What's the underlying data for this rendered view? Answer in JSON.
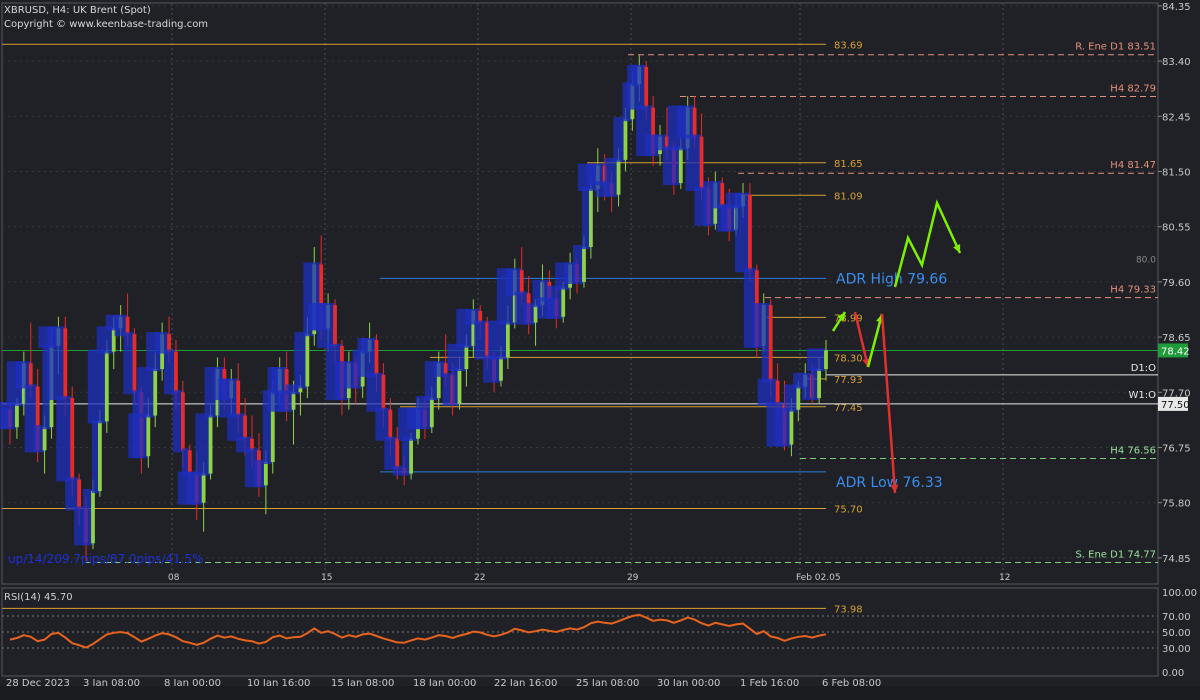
{
  "header": {
    "title": "XBRUSD, H4:  UK Brent (Spot)",
    "copyright": "Copyright © www.keenbase-trading.com"
  },
  "chart_data": {
    "type": "candlestick",
    "symbol": "XBRUSD",
    "timeframe": "H4",
    "ylim": [
      74.4,
      84.4
    ],
    "price_ticks": [
      "84.35",
      "83.40",
      "82.45",
      "81.50",
      "80.55",
      "79.60",
      "78.65",
      "77.70",
      "76.75",
      "75.80",
      "74.85"
    ],
    "date_ticks": [
      "28 Dec 2023",
      "3 Jan 08:00",
      "8 Jan 00:00",
      "10 Jan 16:00",
      "15 Jan 08:00",
      "18 Jan 00:00",
      "22 Jan 16:00",
      "25 Jan 08:00",
      "30 Jan 00:00",
      "1 Feb 16:00",
      "6 Feb 08:00"
    ],
    "period_separators": [
      "08",
      "15",
      "22",
      "29",
      "Feb 02.05",
      "12"
    ],
    "current_price": "78.42",
    "level_lines": [
      {
        "price": 83.69,
        "label": "83.69",
        "color": "#d7a034"
      },
      {
        "price": 81.65,
        "label": "81.65",
        "color": "#d7a034"
      },
      {
        "price": 81.09,
        "label": "81.09",
        "color": "#d7a034"
      },
      {
        "price": 78.99,
        "label": "78.99",
        "color": "#d7a034"
      },
      {
        "price": 78.3,
        "label": "78.30",
        "color": "#d7a034"
      },
      {
        "price": 77.93,
        "label": "77.93",
        "color": "#d7a034"
      },
      {
        "price": 77.45,
        "label": "77.45",
        "color": "#d7a034"
      },
      {
        "price": 75.7,
        "label": "75.70",
        "color": "#d7a034"
      },
      {
        "price": 73.98,
        "label": "73.98",
        "color": "#d7a034"
      }
    ],
    "resistance_levels": [
      {
        "price": 83.51,
        "label": "R. Ene D1 83.51"
      },
      {
        "price": 82.79,
        "label": "H4 82.79"
      },
      {
        "price": 81.47,
        "label": "H4 81.47"
      },
      {
        "price": 79.33,
        "label": "H4 79.33"
      }
    ],
    "support_levels": [
      {
        "price": 76.56,
        "label": "H4 76.56"
      },
      {
        "price": 74.77,
        "label": "S. Ene D1 74.77"
      }
    ],
    "adr": {
      "high_label": "ADR High  79.66",
      "high": 79.66,
      "low_label": "ADR Low  76.33",
      "low": 76.33
    },
    "pivots": {
      "d1": {
        "label": "D1:O",
        "price": 78.0
      },
      "w1": {
        "label": "W1:O",
        "price": 77.5,
        "value": "77.50"
      }
    },
    "round_level": {
      "price": 80.0,
      "label": "80.0"
    },
    "stats_text": "up/14/209.7pips/87.0pips/41.5%",
    "rsi": {
      "label": "RSI(14) 45.70",
      "ylim": [
        0,
        100
      ],
      "ticks": [
        "100.00",
        "70.00",
        "50.00",
        "30.00",
        "0.00"
      ],
      "levels": [
        70,
        50,
        30
      ]
    },
    "candles": [
      [
        77.4,
        77.5,
        76.8,
        77.1
      ],
      [
        77.1,
        77.6,
        76.9,
        77.5
      ],
      [
        77.5,
        78.4,
        77.3,
        78.2
      ],
      [
        78.2,
        78.9,
        77.6,
        77.8
      ],
      [
        77.8,
        78.1,
        76.5,
        76.7
      ],
      [
        76.7,
        77.3,
        76.3,
        77.1
      ],
      [
        77.1,
        78.8,
        76.9,
        78.5
      ],
      [
        78.5,
        79.0,
        78.0,
        78.8
      ],
      [
        78.8,
        79.0,
        77.3,
        77.6
      ],
      [
        77.6,
        77.8,
        75.9,
        76.2
      ],
      [
        76.2,
        76.3,
        75.4,
        75.7
      ],
      [
        75.7,
        75.9,
        74.8,
        75.1
      ],
      [
        75.1,
        76.2,
        75.0,
        76.0
      ],
      [
        76.0,
        77.4,
        75.9,
        77.2
      ],
      [
        77.2,
        78.6,
        77.0,
        78.4
      ],
      [
        78.4,
        79.0,
        78.1,
        78.8
      ],
      [
        78.8,
        79.2,
        78.4,
        79.0
      ],
      [
        79.0,
        79.4,
        78.5,
        78.7
      ],
      [
        78.7,
        78.8,
        77.5,
        77.7
      ],
      [
        77.7,
        77.8,
        76.3,
        76.6
      ],
      [
        76.6,
        77.6,
        76.4,
        77.3
      ],
      [
        77.3,
        78.4,
        77.1,
        78.1
      ],
      [
        78.1,
        78.9,
        77.9,
        78.7
      ],
      [
        78.7,
        79.0,
        78.2,
        78.4
      ],
      [
        78.4,
        78.6,
        77.4,
        77.7
      ],
      [
        77.7,
        77.9,
        76.4,
        76.7
      ],
      [
        76.7,
        76.8,
        76.0,
        76.3
      ],
      [
        76.3,
        76.7,
        75.5,
        75.8
      ],
      [
        75.8,
        76.5,
        75.3,
        76.3
      ],
      [
        76.3,
        77.5,
        76.2,
        77.3
      ],
      [
        77.3,
        78.3,
        77.1,
        78.1
      ],
      [
        78.1,
        78.3,
        77.4,
        77.6
      ],
      [
        77.6,
        78.1,
        77.3,
        77.9
      ],
      [
        77.9,
        78.2,
        77.0,
        77.3
      ],
      [
        77.3,
        77.6,
        76.6,
        76.9
      ],
      [
        76.9,
        77.3,
        76.4,
        76.7
      ],
      [
        76.7,
        77.0,
        75.9,
        76.1
      ],
      [
        76.1,
        76.7,
        75.6,
        76.5
      ],
      [
        76.5,
        77.9,
        76.3,
        77.7
      ],
      [
        77.7,
        78.3,
        77.5,
        78.1
      ],
      [
        78.1,
        78.4,
        77.2,
        77.4
      ],
      [
        77.4,
        77.9,
        76.8,
        77.7
      ],
      [
        77.7,
        78.0,
        77.3,
        77.8
      ],
      [
        77.8,
        79.0,
        77.6,
        78.7
      ],
      [
        78.7,
        80.2,
        78.5,
        79.9
      ],
      [
        79.9,
        80.4,
        78.6,
        78.8
      ],
      [
        78.8,
        79.4,
        78.4,
        79.2
      ],
      [
        79.2,
        79.3,
        78.2,
        78.5
      ],
      [
        78.5,
        78.6,
        77.3,
        77.6
      ],
      [
        77.6,
        78.4,
        77.4,
        78.2
      ],
      [
        78.2,
        78.3,
        77.5,
        77.8
      ],
      [
        77.8,
        78.6,
        77.6,
        78.4
      ],
      [
        78.4,
        78.9,
        78.2,
        78.6
      ],
      [
        78.6,
        78.7,
        77.7,
        78.0
      ],
      [
        78.0,
        78.2,
        77.1,
        77.4
      ],
      [
        77.4,
        77.6,
        76.6,
        76.9
      ],
      [
        76.9,
        77.1,
        76.2,
        76.4
      ],
      [
        76.4,
        76.6,
        76.1,
        76.3
      ],
      [
        76.3,
        77.0,
        76.2,
        76.9
      ],
      [
        76.9,
        77.6,
        76.8,
        77.4
      ],
      [
        77.4,
        77.6,
        76.9,
        77.1
      ],
      [
        77.1,
        77.8,
        77.0,
        77.6
      ],
      [
        77.6,
        78.4,
        77.4,
        78.2
      ],
      [
        78.2,
        78.7,
        77.8,
        78.0
      ],
      [
        78.0,
        78.2,
        77.3,
        77.5
      ],
      [
        77.5,
        78.3,
        77.4,
        78.1
      ],
      [
        78.1,
        78.7,
        77.8,
        78.5
      ],
      [
        78.5,
        79.3,
        78.3,
        79.1
      ],
      [
        79.1,
        79.2,
        78.6,
        78.9
      ],
      [
        78.9,
        79.0,
        78.1,
        78.3
      ],
      [
        78.3,
        78.4,
        77.7,
        77.9
      ],
      [
        77.9,
        78.5,
        77.8,
        78.3
      ],
      [
        78.3,
        79.2,
        78.1,
        78.9
      ],
      [
        78.9,
        80.0,
        78.8,
        79.8
      ],
      [
        79.8,
        80.2,
        79.2,
        79.4
      ],
      [
        79.4,
        79.7,
        78.7,
        78.9
      ],
      [
        78.9,
        79.3,
        78.5,
        79.2
      ],
      [
        79.2,
        79.9,
        79.0,
        79.6
      ],
      [
        79.6,
        79.8,
        79.1,
        79.3
      ],
      [
        79.3,
        79.5,
        78.8,
        79.0
      ],
      [
        79.0,
        79.6,
        78.9,
        79.5
      ],
      [
        79.5,
        80.1,
        79.3,
        79.9
      ],
      [
        79.9,
        80.0,
        79.4,
        79.6
      ],
      [
        79.6,
        80.4,
        79.5,
        80.2
      ],
      [
        80.2,
        81.4,
        80.0,
        81.2
      ],
      [
        81.2,
        81.9,
        80.8,
        81.6
      ],
      [
        81.6,
        81.8,
        81.0,
        81.3
      ],
      [
        81.3,
        81.5,
        80.8,
        81.1
      ],
      [
        81.1,
        81.9,
        80.9,
        81.7
      ],
      [
        81.7,
        82.6,
        81.5,
        82.4
      ],
      [
        82.4,
        83.2,
        82.2,
        83.0
      ],
      [
        83.0,
        83.5,
        82.7,
        83.3
      ],
      [
        83.3,
        83.4,
        82.4,
        82.6
      ],
      [
        82.6,
        82.8,
        81.6,
        81.8
      ],
      [
        81.8,
        82.3,
        81.6,
        82.1
      ],
      [
        82.1,
        82.6,
        81.7,
        81.9
      ],
      [
        81.9,
        82.0,
        81.1,
        81.3
      ],
      [
        81.3,
        82.1,
        81.2,
        81.9
      ],
      [
        81.9,
        82.8,
        81.7,
        82.6
      ],
      [
        82.6,
        82.8,
        81.9,
        82.1
      ],
      [
        82.1,
        82.5,
        81.0,
        81.2
      ],
      [
        81.2,
        81.4,
        80.4,
        80.6
      ],
      [
        80.6,
        81.5,
        80.5,
        81.3
      ],
      [
        81.3,
        81.4,
        80.7,
        80.9
      ],
      [
        80.9,
        81.2,
        80.3,
        80.5
      ],
      [
        80.5,
        81.1,
        80.4,
        80.9
      ],
      [
        80.9,
        81.3,
        80.7,
        81.1
      ],
      [
        81.1,
        81.3,
        79.6,
        79.8
      ],
      [
        79.8,
        79.9,
        78.3,
        78.5
      ],
      [
        78.5,
        79.4,
        78.4,
        79.2
      ],
      [
        79.2,
        79.3,
        77.6,
        77.9
      ],
      [
        77.9,
        78.2,
        77.2,
        77.5
      ],
      [
        77.5,
        77.9,
        76.7,
        76.8
      ],
      [
        76.8,
        77.6,
        76.6,
        77.4
      ],
      [
        77.4,
        77.9,
        77.2,
        77.8
      ],
      [
        77.8,
        78.2,
        77.6,
        78.0
      ],
      [
        78.0,
        78.2,
        77.5,
        77.6
      ],
      [
        77.6,
        78.3,
        77.5,
        78.1
      ],
      [
        78.1,
        78.6,
        77.9,
        78.42
      ]
    ],
    "projection_arrows": [
      {
        "color": "#7cf000",
        "points": [
          [
            833,
            331
          ],
          [
            845,
            312
          ]
        ]
      },
      {
        "color": "#e03030",
        "points": [
          [
            855,
            312
          ],
          [
            868,
            367
          ]
        ]
      },
      {
        "color": "#7cf000",
        "points": [
          [
            868,
            367
          ],
          [
            882,
            314
          ]
        ]
      },
      {
        "color": "#e03030",
        "points": [
          [
            882,
            314
          ],
          [
            895,
            493
          ]
        ]
      },
      {
        "color": "#7cf000",
        "points": [
          [
            895,
            287
          ],
          [
            908,
            238
          ],
          [
            922,
            265
          ],
          [
            937,
            203
          ],
          [
            960,
            253
          ]
        ]
      }
    ]
  }
}
